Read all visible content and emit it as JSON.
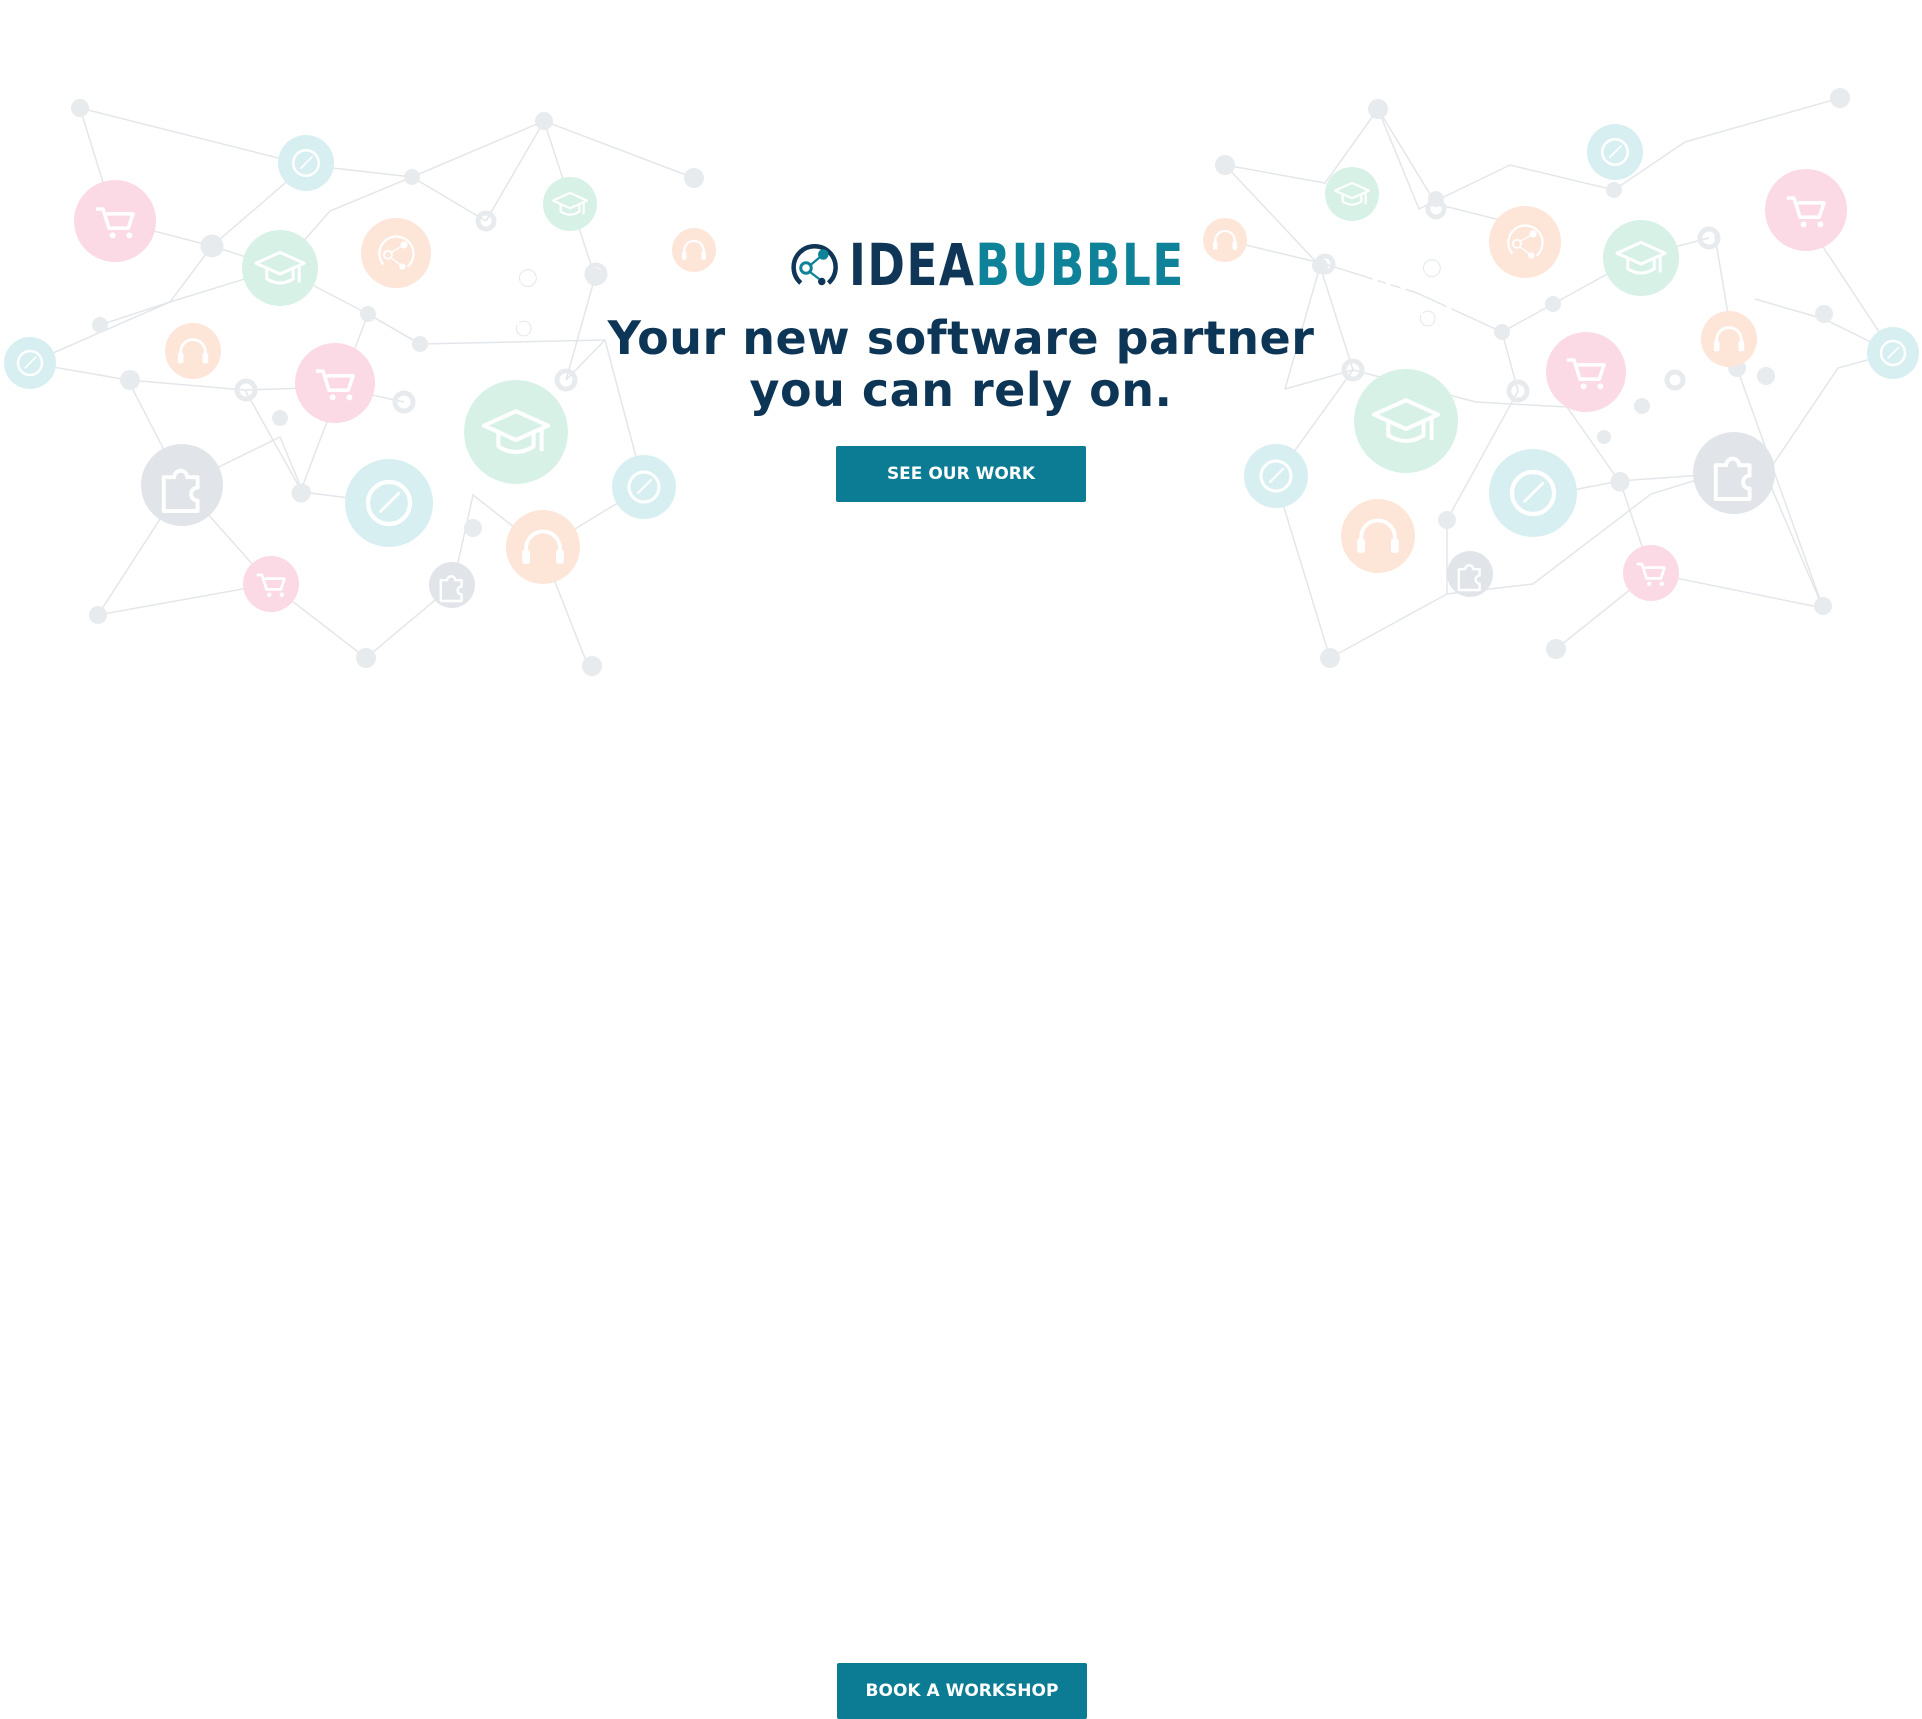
{
  "brand": {
    "name_part1": "IDEA",
    "name_part2": "BUBBLE",
    "primary_color": "#0f3557",
    "accent_color": "#0e8298"
  },
  "hero": {
    "headline_line1": "Your new software partner",
    "headline_line2": "you can rely on.",
    "cta_label": "SEE OUR WORK",
    "background_icons": [
      "shopping-cart-icon",
      "graduation-cap-icon",
      "compass-icon",
      "headphones-icon",
      "puzzle-piece-icon",
      "idea-bubble-icon"
    ]
  },
  "footer_cta": {
    "label": "BOOK A WORKSHOP"
  },
  "colors": {
    "button": "#0b7c93",
    "pink": "#f9d6e2",
    "mint": "#d6f0e6",
    "peach": "#fde3d6",
    "teal": "#d5eef1",
    "grey": "#dde2e8"
  }
}
